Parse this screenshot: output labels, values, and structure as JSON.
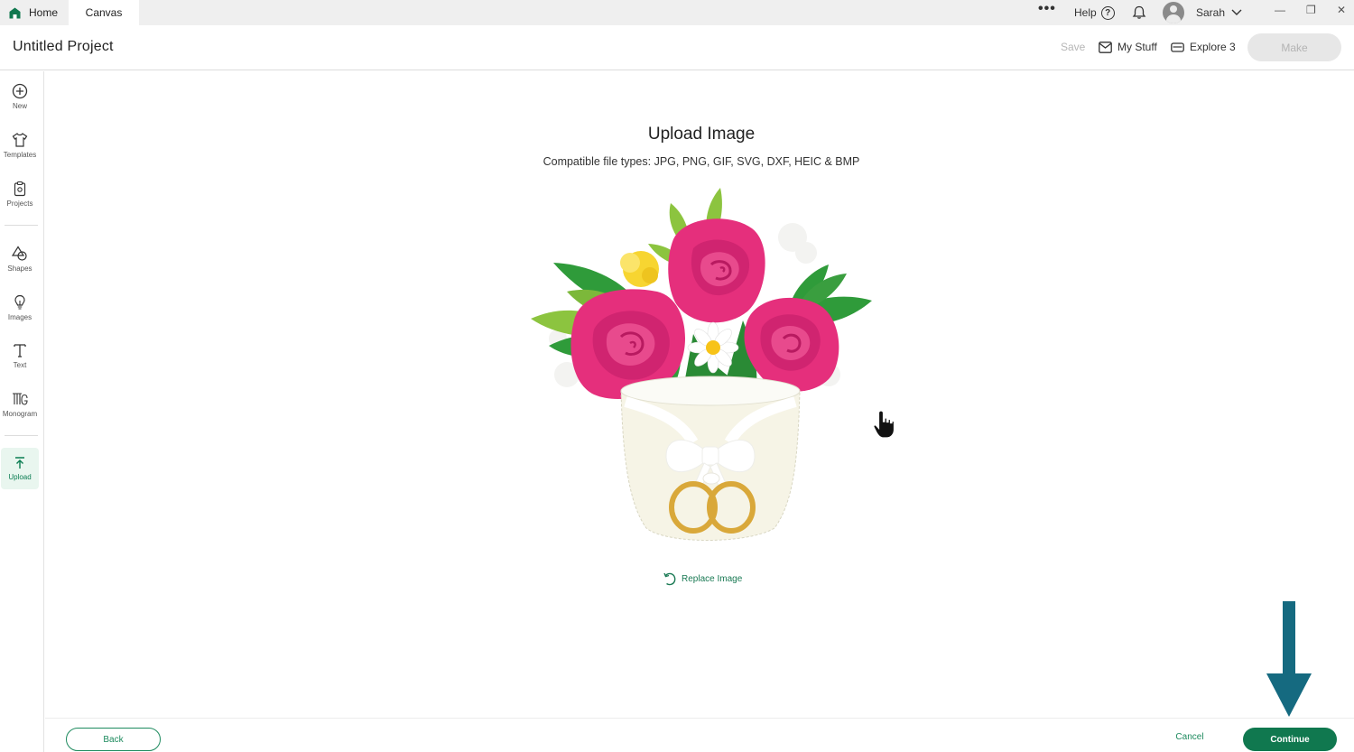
{
  "titlebar": {
    "home_tab": "Home",
    "canvas_tab": "Canvas",
    "more": "•••",
    "help_label": "Help",
    "help_icon": "?",
    "user_name": "Sarah",
    "window": {
      "minimize": "—",
      "restore": "❐",
      "close": "✕"
    }
  },
  "header": {
    "project_title": "Untitled Project",
    "save_label": "Save",
    "mystuff_label": "My Stuff",
    "explore_label": "Explore 3",
    "make_label": "Make"
  },
  "sidebar": {
    "items": [
      {
        "label": "New",
        "icon": "plus-circle-icon"
      },
      {
        "label": "Templates",
        "icon": "shirt-icon"
      },
      {
        "label": "Projects",
        "icon": "clipboard-icon"
      },
      {
        "label": "Shapes",
        "icon": "shapes-icon"
      },
      {
        "label": "Images",
        "icon": "lightbulb-icon"
      },
      {
        "label": "Text",
        "icon": "text-icon"
      },
      {
        "label": "Monogram",
        "icon": "monogram-icon"
      },
      {
        "label": "Upload",
        "icon": "upload-icon"
      }
    ]
  },
  "main": {
    "title": "Upload Image",
    "subtitle": "Compatible file types:  JPG, PNG, GIF, SVG, DXF, HEIC & BMP",
    "replace_label": "Replace Image"
  },
  "footer": {
    "back_label": "Back",
    "cancel_label": "Cancel",
    "continue_label": "Continue"
  },
  "colors": {
    "brand_green": "#10784f",
    "accent_arrow": "#156a80",
    "rose": "#e52f7c",
    "leaf": "#2f9b3a"
  }
}
